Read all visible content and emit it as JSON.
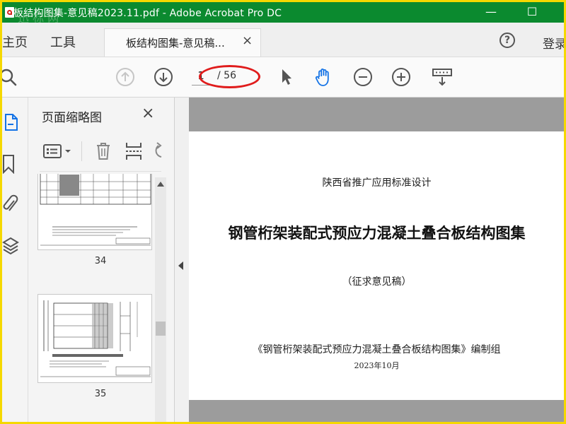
{
  "window": {
    "title": "板结构图集-意见稿2023.11.pdf - Adobe Acrobat Pro DC",
    "watermark": "迅 标 网",
    "minimize": "—",
    "maximize": "☐"
  },
  "tabs": {
    "home": "主页",
    "tools": "工具",
    "document": "板结构图集-意见稿...",
    "document_close": "×",
    "help": "?",
    "login": "登录"
  },
  "toolbar": {
    "icons": [
      "search-icon",
      "page-up-icon",
      "page-down-icon",
      "select-arrow-icon",
      "hand-icon",
      "zoom-out-icon",
      "zoom-in-icon",
      "scroll-mode-icon"
    ],
    "current_page": "1",
    "total_pages": "/ 56"
  },
  "rail": {
    "icons": [
      "pages-icon",
      "bookmark-icon",
      "attachment-icon",
      "layers-icon"
    ]
  },
  "thumbnails_panel": {
    "title": "页面缩略图",
    "close": "×",
    "tool_icons": [
      "options-icon",
      "delete-icon",
      "insert-page-icon",
      "rotate-icon"
    ],
    "pages": [
      {
        "number": "34"
      },
      {
        "number": "35"
      }
    ]
  },
  "document_page": {
    "line1": "陕西省推广应用标准设计",
    "line2": "钢管桁架装配式预应力混凝土叠合板结构图集",
    "line3": "（征求意见稿）",
    "line4": "《钢管桁架装配式预应力混凝土叠合板结构图集》编制组",
    "line5": "2023年10月"
  },
  "colors": {
    "titlebar": "#0b8a2f",
    "frame_border": "#f5d800",
    "annotation": "#e01c1c"
  }
}
